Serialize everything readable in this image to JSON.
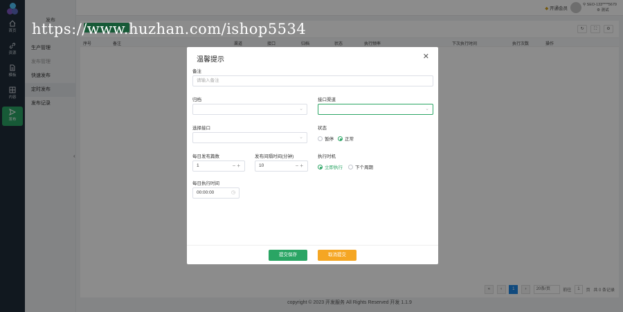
{
  "rail": {
    "items": [
      {
        "label": "首页",
        "icon": "home-icon"
      },
      {
        "label": "资源",
        "icon": "link-icon"
      },
      {
        "label": "模板",
        "icon": "document-icon"
      },
      {
        "label": "内容",
        "icon": "grid-icon"
      },
      {
        "label": "发布",
        "icon": "send-icon",
        "active": true
      }
    ]
  },
  "submenu": {
    "title": "发布",
    "items": [
      {
        "label": "生产管理"
      },
      {
        "label": "发布管理"
      },
      {
        "label": "快速发布"
      },
      {
        "label": "定时发布"
      },
      {
        "label": "发布记录"
      }
    ]
  },
  "topbar": {
    "vip_text": "开通会员",
    "user_name": "SEO-133****5679",
    "user_sub": "测试"
  },
  "table": {
    "headers": [
      "序号",
      "备注",
      "渠道",
      "接口",
      "归档",
      "状态",
      "执行频率",
      "下次执行时间",
      "执行次数",
      "操作"
    ]
  },
  "pager": {
    "current": "1",
    "page_size": "20条/页",
    "goto_label": "前往",
    "goto_value": "1",
    "page_unit": "页",
    "total": "共 0 条记录"
  },
  "footer": {
    "text": "copyright © 2023   开发服务 All Rights Reserved   开发 1.1.9"
  },
  "modal": {
    "title": "温馨提示",
    "close_icon": "close-icon",
    "remark_label": "备注",
    "remark_placeholder": "请输入备注",
    "archive_label": "归档",
    "channel_label": "接口渠道",
    "interface_label": "选择接口",
    "status_label": "状态",
    "status_options": [
      "暂停",
      "正常"
    ],
    "status_selected": "正常",
    "daily_count_label": "每日发布篇数",
    "daily_count_value": "1",
    "interval_label": "发布间隔时间(分钟)",
    "interval_value": "10",
    "exec_label": "执行时机",
    "exec_options": [
      "立即执行",
      "下个周期"
    ],
    "exec_selected": "立即执行",
    "daily_time_label": "每日执行时间",
    "daily_time_value": "00:00:00",
    "save_label": "提交保存",
    "cancel_label": "取消提交"
  },
  "watermark": "https://www.huzhan.com/ishop5534",
  "colors": {
    "accent": "#2aa564",
    "warning": "#f5a623",
    "rail_bg": "#1f2d3a",
    "pager_active": "#1e88e5"
  }
}
